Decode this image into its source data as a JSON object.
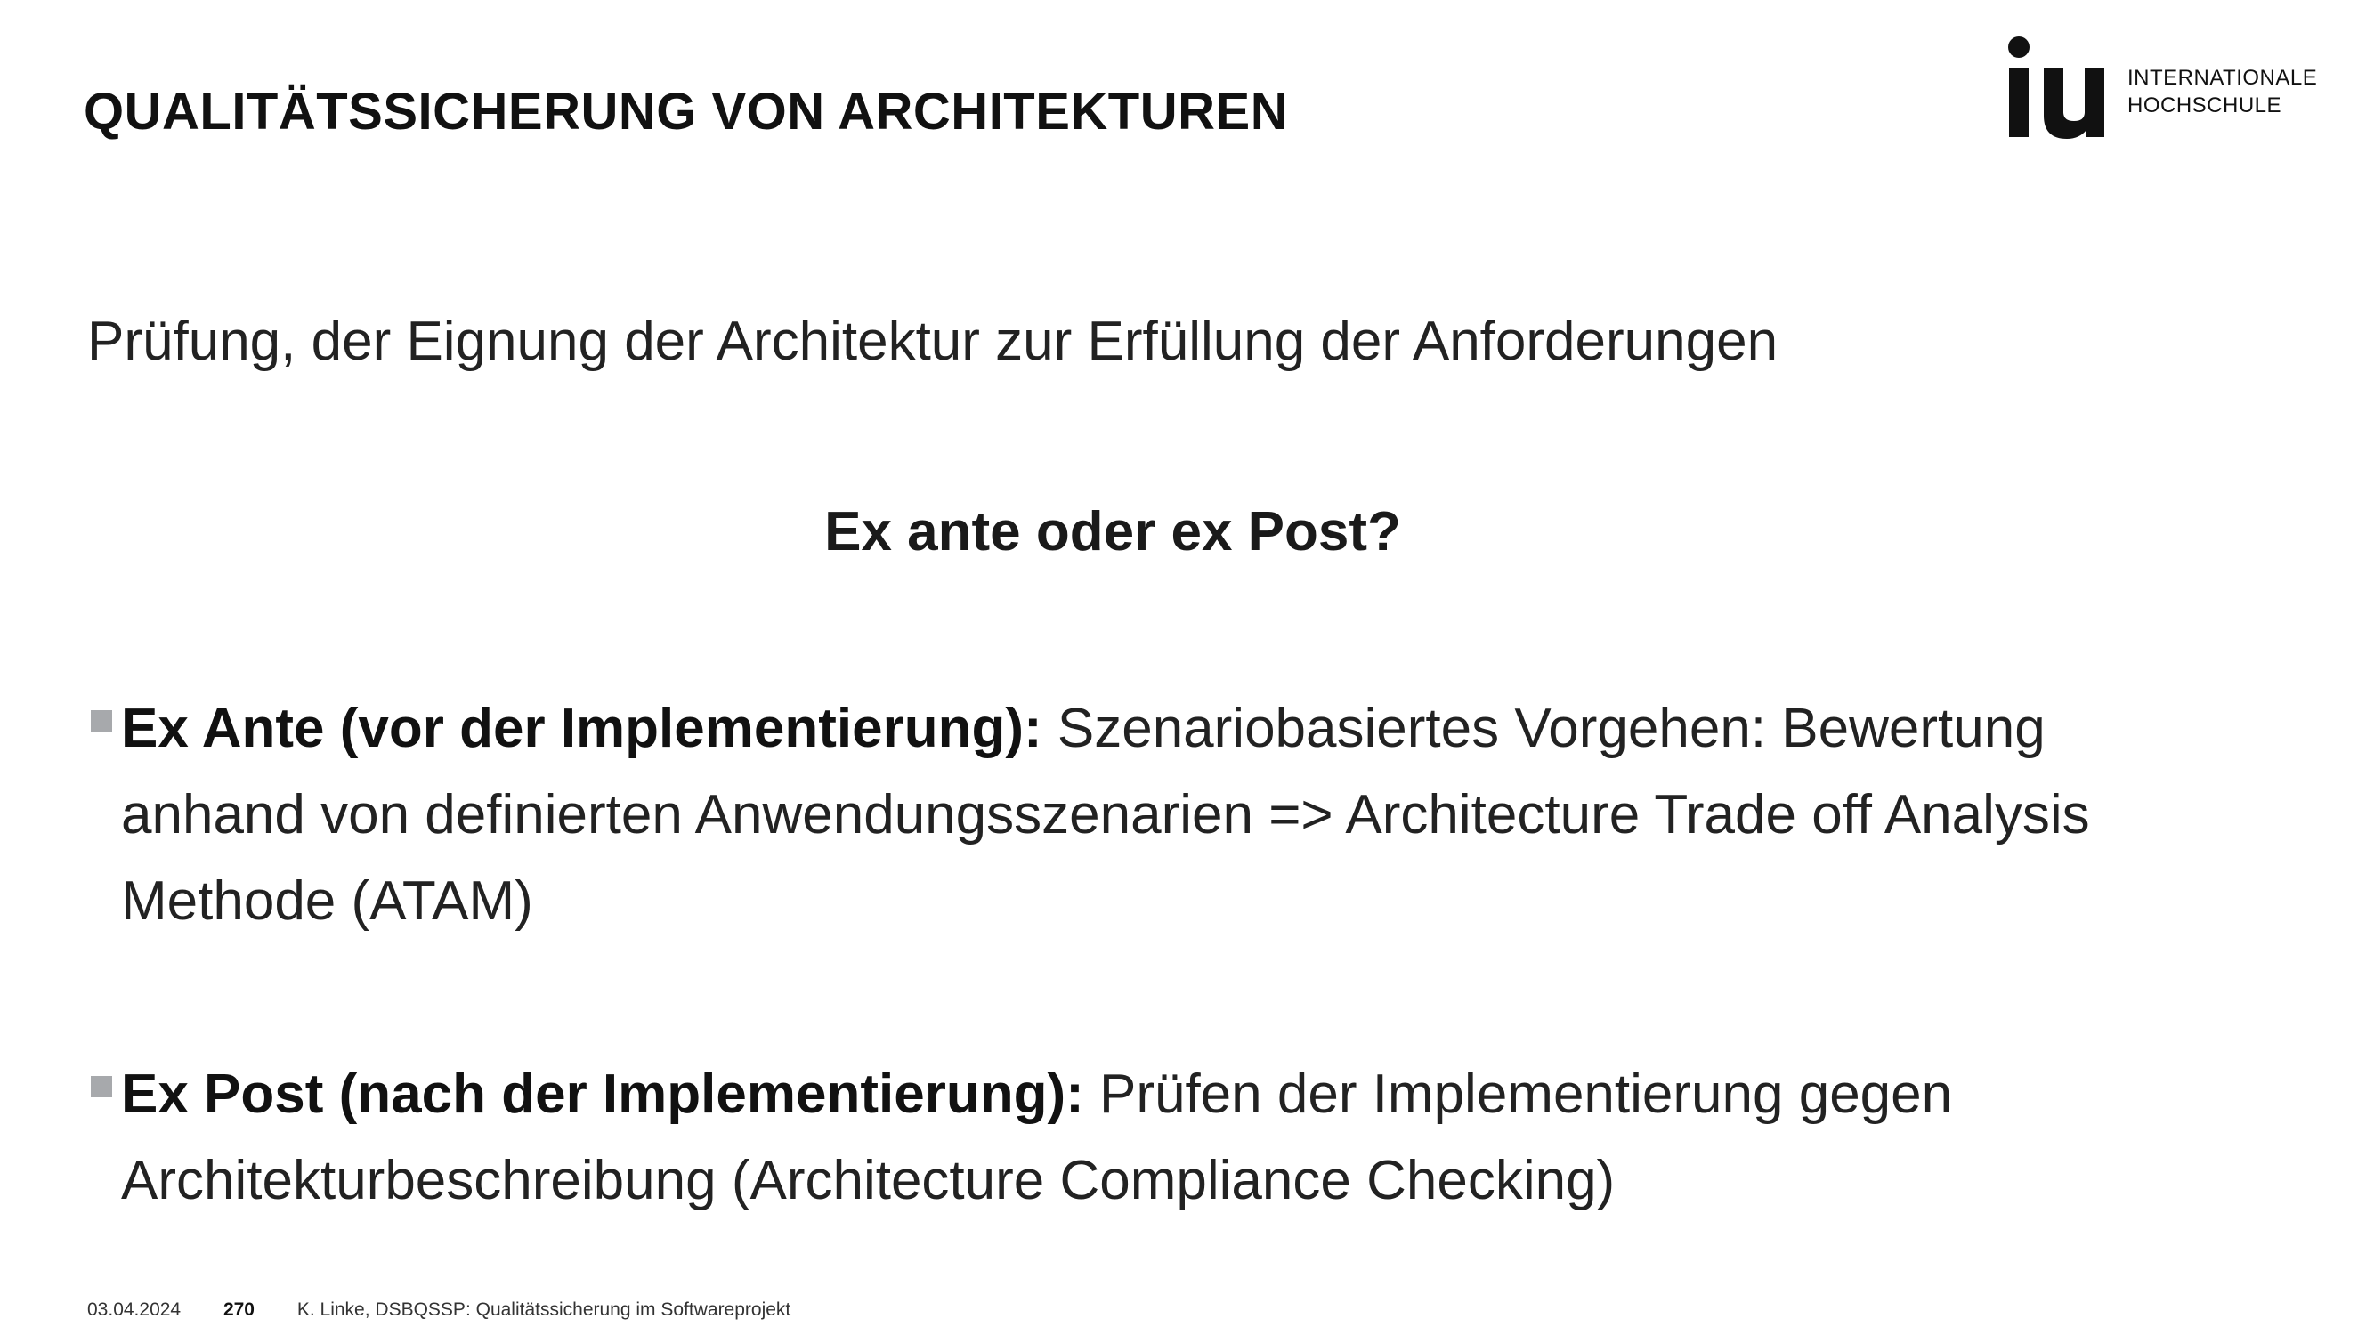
{
  "slide": {
    "title": "QUALITÄTSSICHERUNG VON ARCHITEKTUREN",
    "intro": "Prüfung, der Eignung der Architektur zur Erfüllung der Anforderungen",
    "question": "Ex ante oder ex Post?",
    "bullets": [
      {
        "term": "Ex Ante (vor der Implementierung):",
        "text": "Szenariobasiertes Vorgehen: Bewertung anhand von definierten Anwendungsszenarien => Architecture Trade off Analysis Methode (ATAM)"
      },
      {
        "term": "Ex Post (nach der Implementierung):",
        "text": "Prüfen der Implementierung gegen Architekturbeschreibung (Architecture Compliance Checking)"
      }
    ]
  },
  "logo": {
    "mark": "iu",
    "line1": "INTERNATIONALE",
    "line2": "HOCHSCHULE"
  },
  "footer": {
    "date": "03.04.2024",
    "page": "270",
    "author": "K. Linke,",
    "course": "DSBQSSP: Qualitätssicherung im Softwareprojekt"
  },
  "colors": {
    "text": "#1a1a1a",
    "bullet_marker": "#a7a9ac",
    "background": "#ffffff"
  }
}
